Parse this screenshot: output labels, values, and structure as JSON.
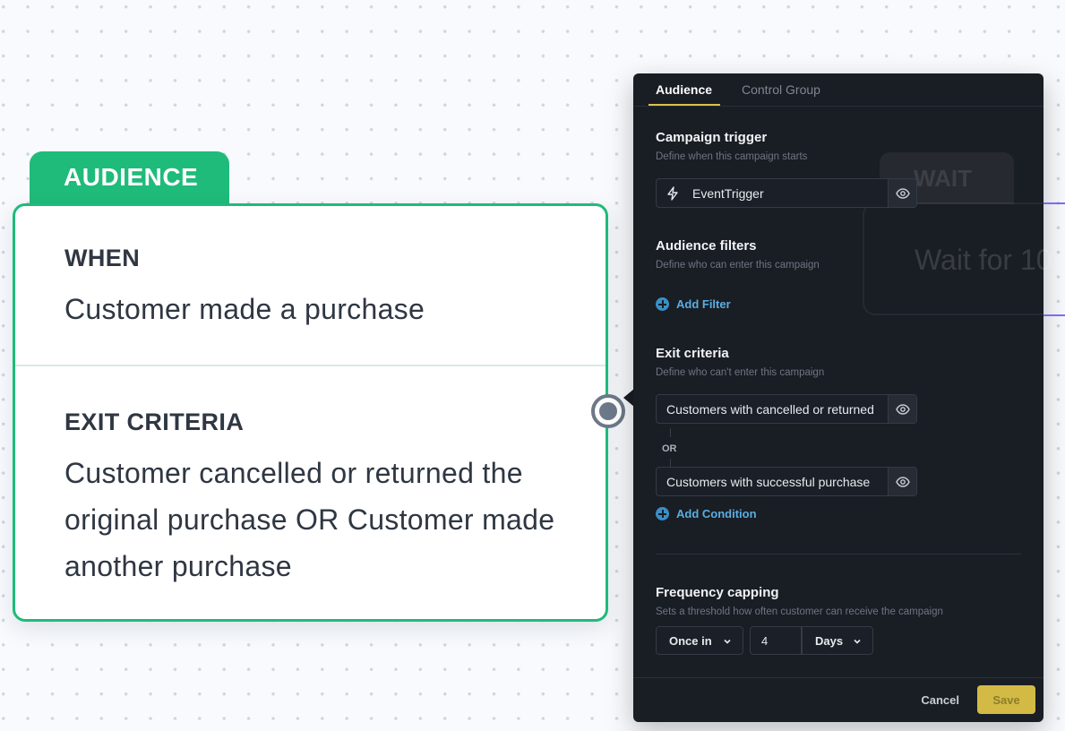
{
  "node": {
    "label": "AUDIENCE",
    "when_heading": "WHEN",
    "when_text": "Customer made a purchase",
    "exit_heading": "EXIT CRITERIA",
    "exit_text": "Customer cancelled or returned the original purchase OR Customer made another purchase",
    "accent_color": "#1fbb7a"
  },
  "background_node": {
    "label": "WAIT",
    "text": "Wait for 10"
  },
  "panel": {
    "tabs": [
      "Audience",
      "Control Group"
    ],
    "active_tab": "Audience",
    "trigger": {
      "title": "Campaign trigger",
      "subtitle": "Define when this campaign starts",
      "value": "EventTrigger",
      "icon": "lightning-icon"
    },
    "filters": {
      "title": "Audience filters",
      "subtitle": "Define who can enter this campaign",
      "add_label": "Add Filter"
    },
    "exit": {
      "title": "Exit criteria",
      "subtitle": "Define who can't enter this campaign",
      "conditions": [
        "Customers with cancelled or returned",
        "Customers with successful purchase"
      ],
      "or_label": "OR",
      "add_label": "Add Condition"
    },
    "frequency": {
      "title": "Frequency capping",
      "subtitle": "Sets a threshold how often customer can receive the campaign",
      "mode": "Once in",
      "count": "4",
      "unit": "Days"
    },
    "footer": {
      "cancel_label": "Cancel",
      "save_label": "Save",
      "save_color": "#d2ba45"
    }
  }
}
